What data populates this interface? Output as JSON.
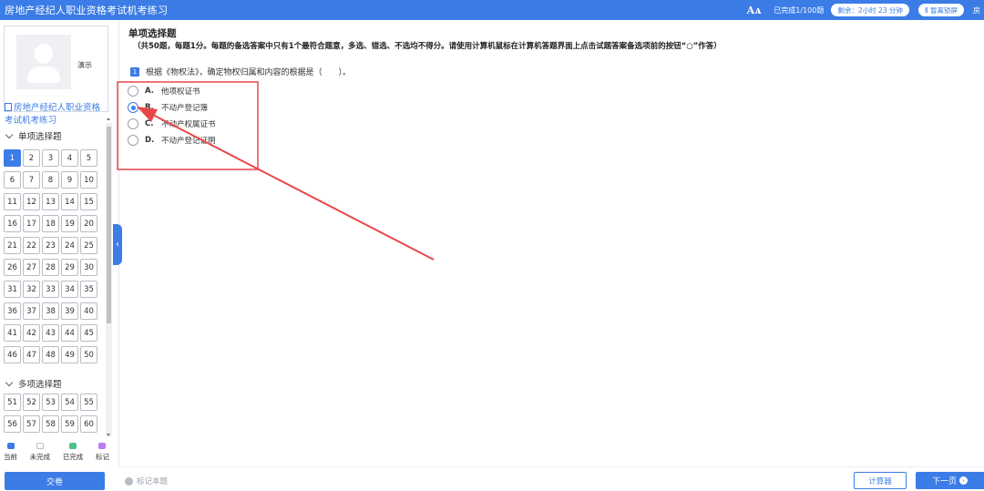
{
  "app": {
    "title": "房地产经纪人职业资格考试机考练习",
    "font_icon": "Aᴀ",
    "progress": "已完成1/100题",
    "timer": "剩余：2小时 23 分钟",
    "pause": "Ⅱ 暂离锁屏",
    "user_cut": "房"
  },
  "sidebar": {
    "photo_label": "演示",
    "exam_link": "房地产经纪人职业资格考试机考练习",
    "single_section": "单项选择题",
    "multi_section": "多项选择题",
    "single_numbers": [
      "1",
      "2",
      "3",
      "4",
      "5",
      "6",
      "7",
      "8",
      "9",
      "10",
      "11",
      "12",
      "13",
      "14",
      "15",
      "16",
      "17",
      "18",
      "19",
      "20",
      "21",
      "22",
      "23",
      "24",
      "25",
      "26",
      "27",
      "28",
      "29",
      "30",
      "31",
      "32",
      "33",
      "34",
      "35",
      "36",
      "37",
      "38",
      "39",
      "40",
      "41",
      "42",
      "43",
      "44",
      "45",
      "46",
      "47",
      "48",
      "49",
      "50"
    ],
    "multi_numbers": [
      "51",
      "52",
      "53",
      "54",
      "55",
      "56",
      "57",
      "58",
      "59",
      "60"
    ],
    "current_question": "1",
    "legend": [
      {
        "label": "当前",
        "color": "#3b7ce6"
      },
      {
        "label": "未完成",
        "color": "#ffffff"
      },
      {
        "label": "已完成",
        "color": "#4cc38a"
      },
      {
        "label": "标记",
        "color": "#b97cf3"
      }
    ],
    "submit_label": "交卷"
  },
  "main": {
    "section_title": "单项选择题",
    "section_desc": "（共50题，每题1分。每题的备选答案中只有1个最符合题意，多选、错选、不选均不得分。请使用计算机鼠标在计算机答题界面上点击试题答案备选项前的按钮“○”作答）",
    "question_number": "1",
    "question_text": "根据《物权法》，确定物权归属和内容的根据是（　　）。",
    "options": [
      {
        "letter": "A.",
        "text": "他项权证书",
        "checked": false
      },
      {
        "letter": "B.",
        "text": "不动产登记簿",
        "checked": true
      },
      {
        "letter": "C.",
        "text": "不动产权属证书",
        "checked": false
      },
      {
        "letter": "D.",
        "text": "不动产登记证明",
        "checked": false
      }
    ]
  },
  "bottom": {
    "mark_label": "标记本题",
    "calc_label": "计算器",
    "next_label": "下一页"
  },
  "colors": {
    "accent": "#3b7ce6",
    "annotation": "#e8474a"
  }
}
